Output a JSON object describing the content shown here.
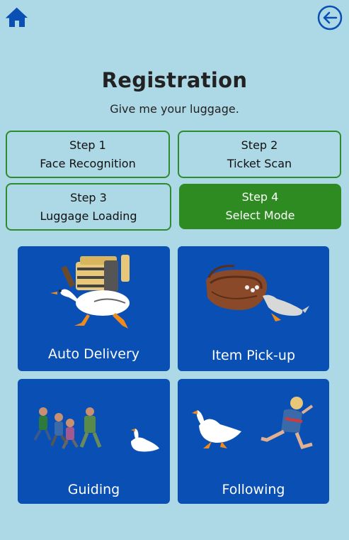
{
  "header": {
    "home_icon": "home-icon",
    "back_icon": "arrow-left-circle-icon",
    "accent": "#0a4fb3"
  },
  "page": {
    "title": "Registration",
    "subtitle": "Give me your luggage."
  },
  "steps": [
    {
      "step": "Step 1",
      "label": "Face Recognition",
      "active": false
    },
    {
      "step": "Step 2",
      "label": "Ticket Scan",
      "active": false
    },
    {
      "step": "Step 3",
      "label": "Luggage Loading",
      "active": false
    },
    {
      "step": "Step 4",
      "label": "Select Mode",
      "active": true
    }
  ],
  "modes": [
    {
      "label": "Auto Delivery",
      "image": "goose-carrying-luggage-image"
    },
    {
      "label": "Item Pick-up",
      "image": "goose-pulling-basket-image"
    },
    {
      "label": "Guiding",
      "image": "goose-chased-by-people-image"
    },
    {
      "label": "Following",
      "image": "goose-chasing-boy-image"
    }
  ],
  "colors": {
    "background": "#add8e6",
    "step_border": "#2e8b2e",
    "step_active": "#2e8b22",
    "mode_card": "#0a4fb3"
  }
}
